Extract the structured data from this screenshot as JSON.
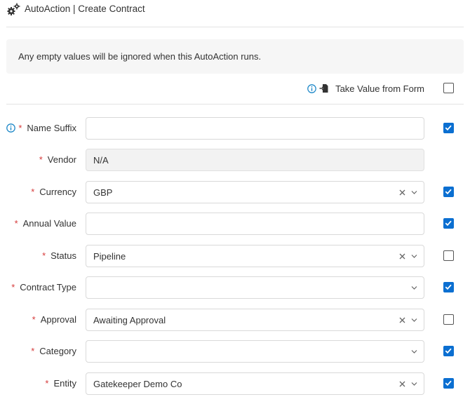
{
  "header": {
    "title": "AutoAction | Create Contract",
    "icon": "gears-icon"
  },
  "notice": {
    "text": "Any empty values will be ignored when this AutoAction runs."
  },
  "take_value": {
    "label": "Take Value from Form",
    "checked": false
  },
  "colors": {
    "accent": "#0b6fd1",
    "required": "#d63a3a",
    "info": "#1e88c8"
  },
  "fields": [
    {
      "label": "Name Suffix",
      "required": true,
      "info": true,
      "type": "text",
      "value": "",
      "checked": true
    },
    {
      "label": "Vendor",
      "required": true,
      "info": false,
      "type": "disabled",
      "value": "N/A",
      "checked": null
    },
    {
      "label": "Currency",
      "required": true,
      "info": false,
      "type": "select",
      "value": "GBP",
      "clearable": true,
      "checked": true
    },
    {
      "label": "Annual Value",
      "required": true,
      "info": false,
      "type": "text",
      "value": "",
      "checked": true
    },
    {
      "label": "Status",
      "required": true,
      "info": false,
      "type": "select",
      "value": "Pipeline",
      "clearable": true,
      "checked": false
    },
    {
      "label": "Contract Type",
      "required": true,
      "info": false,
      "type": "select",
      "value": "",
      "clearable": false,
      "checked": true
    },
    {
      "label": "Approval",
      "required": true,
      "info": false,
      "type": "select",
      "value": "Awaiting Approval",
      "clearable": true,
      "checked": false
    },
    {
      "label": "Category",
      "required": true,
      "info": false,
      "type": "select",
      "value": "",
      "clearable": false,
      "checked": true
    },
    {
      "label": "Entity",
      "required": true,
      "info": false,
      "type": "select",
      "value": "Gatekeeper Demo Co",
      "clearable": true,
      "checked": true
    }
  ]
}
